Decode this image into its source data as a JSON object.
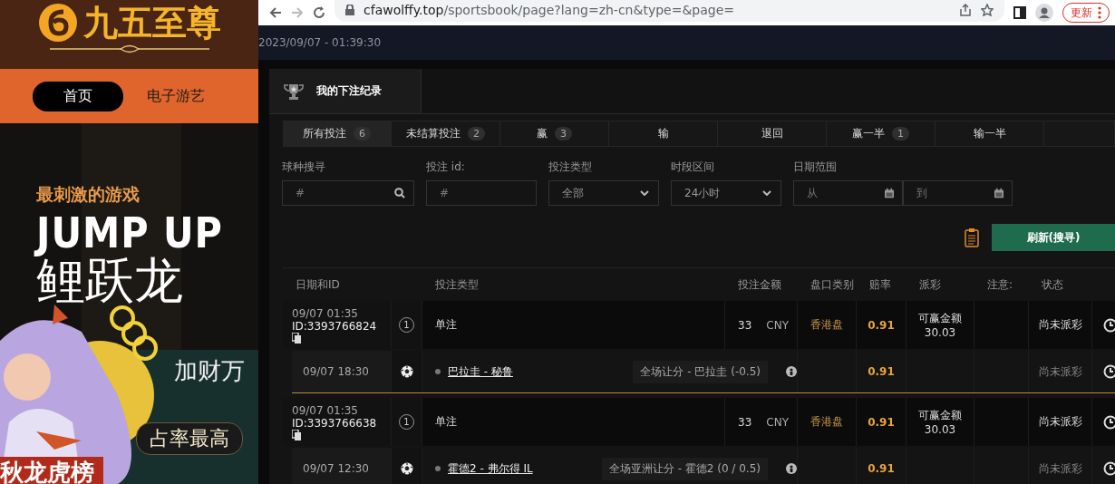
{
  "site": {
    "brand": "九五至尊",
    "nav": [
      {
        "label": "首页",
        "selected": true
      },
      {
        "label": "电子游艺",
        "selected": false
      }
    ],
    "banner": {
      "kind": "picture",
      "tagline": "最刺激的游戏",
      "headline": "JUMP UP",
      "title": "鲤跃龙",
      "subtitle": "加财万",
      "button": "占率最高",
      "ribbon": "秋龙虎榜"
    }
  },
  "browser": {
    "url_host": "cfawolffy.top",
    "url_path": "/sportsbook/page?lang=zh-cn&type=&page=",
    "update_button": "更新"
  },
  "clock": "2023/09/07 - 01:39:30",
  "panel": {
    "title": "我的下注纪录",
    "tabs": [
      {
        "label": "所有投注",
        "count": "6",
        "selected": true
      },
      {
        "label": "未结算投注",
        "count": "2",
        "selected": false
      },
      {
        "label": "赢",
        "count": "3",
        "selected": false
      },
      {
        "label": "输",
        "selected": false
      },
      {
        "label": "退回",
        "selected": false
      },
      {
        "label": "赢一半",
        "count": "1",
        "selected": false
      },
      {
        "label": "输一半",
        "selected": false
      }
    ],
    "filters": [
      {
        "kind": "search",
        "label": "球种搜寻",
        "placeholder": "#"
      },
      {
        "kind": "text",
        "label": "投注 id:",
        "placeholder": "#"
      },
      {
        "kind": "select",
        "label": "投注类型",
        "value": "全部"
      },
      {
        "kind": "select",
        "label": "时段区间",
        "value": "24小时"
      },
      {
        "kind": "daterange",
        "label": "日期范围",
        "from_placeholder": "从",
        "to_placeholder": "到"
      }
    ],
    "refresh_button": "刷新(搜寻)",
    "columns": [
      "日期和ID",
      "投注类型",
      "投注金额",
      "盘口类别",
      "赔率",
      "派彩",
      "注意:",
      "状态"
    ],
    "bets": [
      {
        "date": "09/07 01:35",
        "id": "ID:3393766824",
        "legs_count": "1",
        "type": "单注",
        "amount": "33",
        "currency": "CNY",
        "market": "香港盘",
        "odds": "0.91",
        "payout_label": "可赢金额",
        "payout": "30.03",
        "status": "尚未派彩",
        "legs": [
          {
            "time": "09/07 18:30",
            "match": "巴拉圭 - 秘鲁",
            "selection": "全场让分 - 巴拉圭 (-0.5)",
            "odds": "0.91",
            "status": "尚未派彩"
          }
        ]
      },
      {
        "date": "09/07 01:35",
        "id": "ID:3393766638",
        "legs_count": "1",
        "type": "单注",
        "amount": "33",
        "currency": "CNY",
        "market": "香港盘",
        "odds": "0.91",
        "payout_label": "可赢金额",
        "payout": "30.03",
        "status": "尚未派彩",
        "legs": [
          {
            "time": "09/07 12:30",
            "match": "霍德2 - 弗尔得 IL",
            "selection": "全场亚洲让分 - 霍德2 (0 / 0.5)",
            "odds": "0.91",
            "status": "尚未派彩"
          }
        ]
      }
    ]
  }
}
